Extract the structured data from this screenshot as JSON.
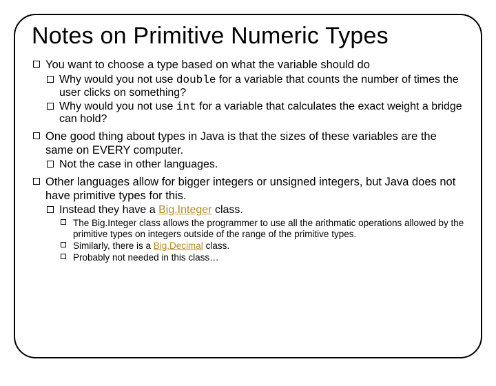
{
  "title": "Notes on Primitive Numeric Types",
  "bullets": {
    "b1": "You want to choose a type based on what the variable should do",
    "b1a_pre": "Why would you not use ",
    "b1a_code": "double",
    "b1a_post": " for a variable that counts the number of times the user clicks on something?",
    "b1b_pre": "Why would you not use ",
    "b1b_code": "int",
    "b1b_post": " for a variable that calculates the exact weight a bridge can hold?",
    "b2": "One good thing about types in Java is that the sizes of these variables are the same on EVERY computer.",
    "b2a": "Not the case in other languages.",
    "b3": "Other languages allow for bigger integers or unsigned integers, but Java does not have primitive types for this.",
    "b3a_pre": "Instead they have a ",
    "b3a_link": "Big.Integer",
    "b3a_post": " class.",
    "b3a1": "The Big.Integer class allows the programmer to use all the arithmatic operations allowed by the primitive types on integers outside of the range of the primitive types.",
    "b3a2_pre": "Similarly, there is a ",
    "b3a2_link": "Big.Decimal",
    "b3a2_post": " class.",
    "b3a3": "Probably not needed in this class…"
  }
}
